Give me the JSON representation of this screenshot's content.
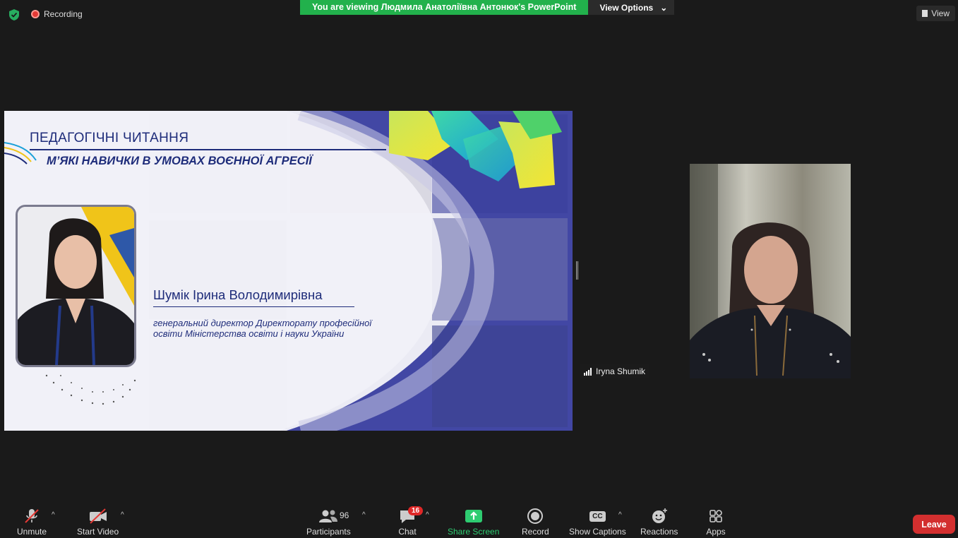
{
  "top_bar": {
    "recording_label": "Recording",
    "banner_text": "You are viewing Людмила Анатоліївна Антонюк's PowerPoint",
    "view_options_label": "View Options",
    "view_label": "View"
  },
  "slide": {
    "title": "ПЕДАГОГІЧНІ ЧИТАННЯ",
    "subtitle": "М’ЯКІ НАВИЧКИ В УМОВАХ ВОЄННОЇ АГРЕСІЇ",
    "speaker_name": "Шумік Ірина Володимирівна",
    "speaker_role_line1": "генеральний директор Директорату професійної",
    "speaker_role_line2": "освіти Міністерства освіти і науки України"
  },
  "video": {
    "participant_name": "Iryna Shumik"
  },
  "toolbar": {
    "unmute": "Unmute",
    "start_video": "Start Video",
    "participants": "Participants",
    "participants_count": "96",
    "chat": "Chat",
    "chat_badge": "16",
    "share_screen": "Share Screen",
    "record": "Record",
    "show_captions": "Show Captions",
    "captions_icon_text": "CC",
    "reactions": "Reactions",
    "apps": "Apps",
    "leave": "Leave"
  },
  "colors": {
    "banner_green": "#22b14c",
    "leave_red": "#d32f2f",
    "slide_navy": "#1e2c7a",
    "share_green": "#2ecc71"
  }
}
